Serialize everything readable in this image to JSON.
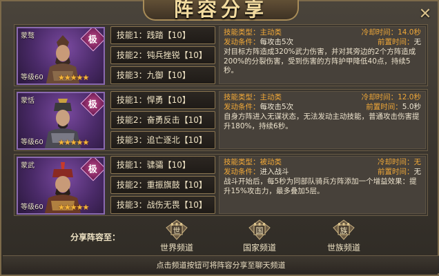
{
  "title": "阵容分享",
  "close_symbol": "✕",
  "heroes": [
    {
      "name": "蒙骜",
      "rank": "极",
      "level": "等级60",
      "stars": "★★★★★",
      "skills": [
        "技能1：践踏【10】",
        "技能2：钝兵挫锐【10】",
        "技能3：九御【10】"
      ],
      "detail": {
        "type_label": "技能类型：",
        "type_value": "主动类",
        "cd_label": "冷却时间：",
        "cd_value": "14.0秒",
        "cond_label": "发动条件：",
        "cond_value": "每攻击5次",
        "prep_label": "前置时间：",
        "prep_value": "无",
        "desc": "对目标方阵造成320%武力伤害，并对其旁边的2个方阵造成200%的分裂伤害，受到伤害的方阵护甲降低40点，持续5秒。"
      }
    },
    {
      "name": "蒙恬",
      "rank": "极",
      "level": "等级60",
      "stars": "★★★★★",
      "skills": [
        "技能1：悍勇【10】",
        "技能2：奋勇反击【10】",
        "技能3：追亡逐北【10】"
      ],
      "detail": {
        "type_label": "技能类型：",
        "type_value": "主动类",
        "cd_label": "冷却时间：",
        "cd_value": "12.0秒",
        "cond_label": "发动条件：",
        "cond_value": "每攻击5次",
        "prep_label": "前置时间：",
        "prep_value": "5.0秒",
        "desc": "自身方阵进入无谋状态，无法发动主动技能，普通攻击伤害提升180%，持续6秒。"
      }
    },
    {
      "name": "蒙武",
      "rank": "极",
      "level": "等级60",
      "stars": "★★★★★",
      "skills": [
        "技能1：骕骦【10】",
        "技能2：重振旗鼓【10】",
        "技能3：战伤无畏【10】"
      ],
      "detail": {
        "type_label": "技能类型：",
        "type_value": "被动类",
        "cd_label": "冷却时间：",
        "cd_value": "无",
        "cond_label": "发动条件：",
        "cond_value": "进入战斗",
        "prep_label": "前置时间：",
        "prep_value": "无",
        "desc": "战斗开始后，每5秒为同部队骑兵方阵添加一个增益效果：提升15%攻击力，最多叠加5层。"
      }
    }
  ],
  "share": {
    "label": "分享阵容至：",
    "channels": [
      {
        "glyph": "世",
        "label": "世界频道",
        "icon": "world-channel-icon"
      },
      {
        "glyph": "国",
        "label": "国家频道",
        "icon": "country-channel-icon"
      },
      {
        "glyph": "族",
        "label": "世族频道",
        "icon": "clan-channel-icon"
      }
    ]
  },
  "footer": "点击频道按钮可将阵容分享至聊天频道",
  "colors": {
    "accent_orange": "#f0a838",
    "text_light": "#efe3c4",
    "rank_purple": "#8a6ab0",
    "star_gold": "#f5b73a"
  }
}
